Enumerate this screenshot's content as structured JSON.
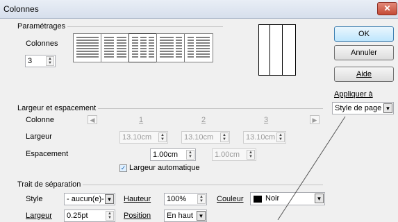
{
  "window": {
    "title": "Colonnes",
    "close_label": "✕"
  },
  "settings": {
    "group_label": "Paramétrages",
    "columns_label": "Colonnes",
    "columns_value": "3",
    "presets": [
      {
        "name": "1 colonne",
        "cols": 1
      },
      {
        "name": "2 colonnes",
        "cols": 2
      },
      {
        "name": "3 colonnes",
        "cols": 3
      },
      {
        "name": "2 colonnes gauche large",
        "cols": 2
      },
      {
        "name": "2 colonnes droite large",
        "cols": 2
      }
    ]
  },
  "buttons": {
    "ok": "OK",
    "cancel": "Annuler",
    "help": "Aide"
  },
  "apply": {
    "label": "Appliquer à",
    "value": "Style de page : S"
  },
  "width_spacing": {
    "group_label": "Largeur et espacement",
    "column_label": "Colonne",
    "col_numbers": [
      "1",
      "2",
      "3"
    ],
    "width_label": "Largeur",
    "widths": [
      "13.10cm",
      "13.10cm",
      "13.10cm"
    ],
    "spacing_label": "Espacement",
    "spacings": [
      "1.00cm",
      "1.00cm"
    ],
    "auto_width_label": "Largeur automatique",
    "auto_width_checked": true
  },
  "separator": {
    "group_label": "Trait de séparation",
    "style_label": "Style",
    "style_value": "- aucun(e)-",
    "height_label": "Hauteur",
    "height_value": "100%",
    "color_label": "Couleur",
    "color_value": "Noir",
    "color_swatch": "#000000",
    "width_label": "Largeur",
    "width_value": "0.25pt",
    "position_label": "Position",
    "position_value": "En haut"
  }
}
